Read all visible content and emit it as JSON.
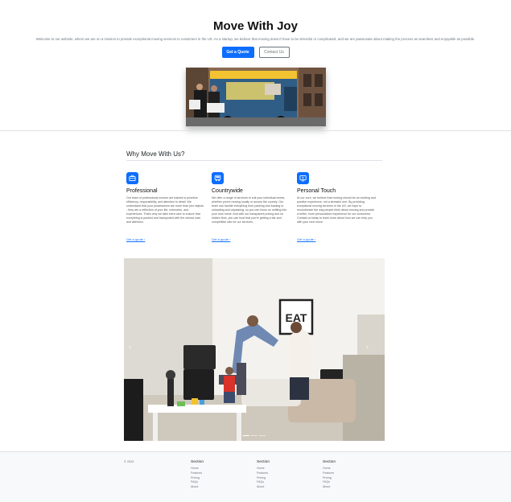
{
  "hero": {
    "title": "Move With Joy",
    "intro": "Welcome to our website, where we are on a mission to provide exceptional moving services to customers in the US. As a startup, we believe that moving doesn't have to be stressful or complicated, and we are passionate about making the process as seamless and enjoyable as possible.",
    "primary_button": "Get a Quote",
    "secondary_button": "Contact Us"
  },
  "features": {
    "heading": "Why Move With Us?",
    "items": [
      {
        "icon": "briefcase-icon",
        "title": "Professional",
        "text": "Our team of professional movers are trained to prioritize efficiency, responsibility, and attention to detail. We understand that your possessions are more than just objects - they are a reflection of your life, memories, and experiences. That's why we take extra care to ensure that everything is packed and transported with the utmost care and attention.",
        "link": "Get a quote"
      },
      {
        "icon": "truck-icon",
        "title": "Countrywide",
        "text": "We offer a range of services to suit your individual needs, whether you're moving locally or across the country. Our team can handle everything from packing and loading to unloading and unpacking, so you can focus on settling into your new home. And with our transparent pricing and no hidden fees, you can trust that you're getting a fair and competitive rate for our services.",
        "link": "Get a quote"
      },
      {
        "icon": "person-video-icon",
        "title": "Personal Touch",
        "text": "At our core, we believe that moving should be an exciting and positive experience, not a stressful one. By providing exceptional moving services in the US, we hope to revolutionize the way people think about moving and provide a better, more personalized experience for our customers. Contact us today to learn more about how we can help you with your next move.",
        "link": "Get a quote"
      }
    ]
  },
  "footer": {
    "copyright": "© 2023",
    "columns": [
      {
        "heading": "Section",
        "links": [
          "Home",
          "Features",
          "Pricing",
          "FAQs",
          "About"
        ]
      },
      {
        "heading": "Section",
        "links": [
          "Home",
          "Features",
          "Pricing",
          "FAQs",
          "About"
        ]
      },
      {
        "heading": "Section",
        "links": [
          "Home",
          "Features",
          "Pricing",
          "FAQs",
          "About"
        ]
      }
    ]
  },
  "colors": {
    "accent": "#0d6efd",
    "footer_bg": "#f8f9fa"
  }
}
